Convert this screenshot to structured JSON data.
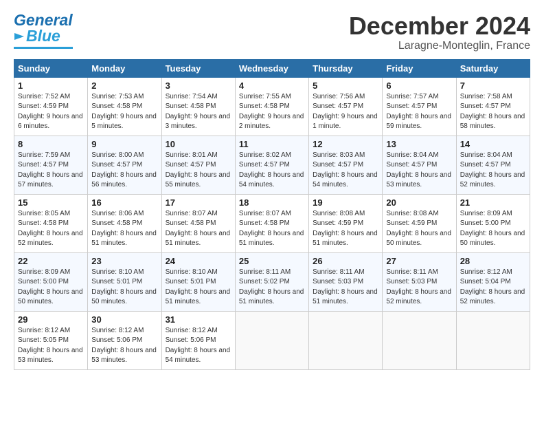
{
  "header": {
    "logo_general": "General",
    "logo_blue": "Blue",
    "month_title": "December 2024",
    "location": "Laragne-Monteglin, France"
  },
  "calendar": {
    "days_of_week": [
      "Sunday",
      "Monday",
      "Tuesday",
      "Wednesday",
      "Thursday",
      "Friday",
      "Saturday"
    ],
    "weeks": [
      [
        {
          "day": "1",
          "sunrise": "Sunrise: 7:52 AM",
          "sunset": "Sunset: 4:59 PM",
          "daylight": "Daylight: 9 hours and 6 minutes."
        },
        {
          "day": "2",
          "sunrise": "Sunrise: 7:53 AM",
          "sunset": "Sunset: 4:58 PM",
          "daylight": "Daylight: 9 hours and 5 minutes."
        },
        {
          "day": "3",
          "sunrise": "Sunrise: 7:54 AM",
          "sunset": "Sunset: 4:58 PM",
          "daylight": "Daylight: 9 hours and 3 minutes."
        },
        {
          "day": "4",
          "sunrise": "Sunrise: 7:55 AM",
          "sunset": "Sunset: 4:58 PM",
          "daylight": "Daylight: 9 hours and 2 minutes."
        },
        {
          "day": "5",
          "sunrise": "Sunrise: 7:56 AM",
          "sunset": "Sunset: 4:57 PM",
          "daylight": "Daylight: 9 hours and 1 minute."
        },
        {
          "day": "6",
          "sunrise": "Sunrise: 7:57 AM",
          "sunset": "Sunset: 4:57 PM",
          "daylight": "Daylight: 8 hours and 59 minutes."
        },
        {
          "day": "7",
          "sunrise": "Sunrise: 7:58 AM",
          "sunset": "Sunset: 4:57 PM",
          "daylight": "Daylight: 8 hours and 58 minutes."
        }
      ],
      [
        {
          "day": "8",
          "sunrise": "Sunrise: 7:59 AM",
          "sunset": "Sunset: 4:57 PM",
          "daylight": "Daylight: 8 hours and 57 minutes."
        },
        {
          "day": "9",
          "sunrise": "Sunrise: 8:00 AM",
          "sunset": "Sunset: 4:57 PM",
          "daylight": "Daylight: 8 hours and 56 minutes."
        },
        {
          "day": "10",
          "sunrise": "Sunrise: 8:01 AM",
          "sunset": "Sunset: 4:57 PM",
          "daylight": "Daylight: 8 hours and 55 minutes."
        },
        {
          "day": "11",
          "sunrise": "Sunrise: 8:02 AM",
          "sunset": "Sunset: 4:57 PM",
          "daylight": "Daylight: 8 hours and 54 minutes."
        },
        {
          "day": "12",
          "sunrise": "Sunrise: 8:03 AM",
          "sunset": "Sunset: 4:57 PM",
          "daylight": "Daylight: 8 hours and 54 minutes."
        },
        {
          "day": "13",
          "sunrise": "Sunrise: 8:04 AM",
          "sunset": "Sunset: 4:57 PM",
          "daylight": "Daylight: 8 hours and 53 minutes."
        },
        {
          "day": "14",
          "sunrise": "Sunrise: 8:04 AM",
          "sunset": "Sunset: 4:57 PM",
          "daylight": "Daylight: 8 hours and 52 minutes."
        }
      ],
      [
        {
          "day": "15",
          "sunrise": "Sunrise: 8:05 AM",
          "sunset": "Sunset: 4:58 PM",
          "daylight": "Daylight: 8 hours and 52 minutes."
        },
        {
          "day": "16",
          "sunrise": "Sunrise: 8:06 AM",
          "sunset": "Sunset: 4:58 PM",
          "daylight": "Daylight: 8 hours and 51 minutes."
        },
        {
          "day": "17",
          "sunrise": "Sunrise: 8:07 AM",
          "sunset": "Sunset: 4:58 PM",
          "daylight": "Daylight: 8 hours and 51 minutes."
        },
        {
          "day": "18",
          "sunrise": "Sunrise: 8:07 AM",
          "sunset": "Sunset: 4:58 PM",
          "daylight": "Daylight: 8 hours and 51 minutes."
        },
        {
          "day": "19",
          "sunrise": "Sunrise: 8:08 AM",
          "sunset": "Sunset: 4:59 PM",
          "daylight": "Daylight: 8 hours and 51 minutes."
        },
        {
          "day": "20",
          "sunrise": "Sunrise: 8:08 AM",
          "sunset": "Sunset: 4:59 PM",
          "daylight": "Daylight: 8 hours and 50 minutes."
        },
        {
          "day": "21",
          "sunrise": "Sunrise: 8:09 AM",
          "sunset": "Sunset: 5:00 PM",
          "daylight": "Daylight: 8 hours and 50 minutes."
        }
      ],
      [
        {
          "day": "22",
          "sunrise": "Sunrise: 8:09 AM",
          "sunset": "Sunset: 5:00 PM",
          "daylight": "Daylight: 8 hours and 50 minutes."
        },
        {
          "day": "23",
          "sunrise": "Sunrise: 8:10 AM",
          "sunset": "Sunset: 5:01 PM",
          "daylight": "Daylight: 8 hours and 50 minutes."
        },
        {
          "day": "24",
          "sunrise": "Sunrise: 8:10 AM",
          "sunset": "Sunset: 5:01 PM",
          "daylight": "Daylight: 8 hours and 51 minutes."
        },
        {
          "day": "25",
          "sunrise": "Sunrise: 8:11 AM",
          "sunset": "Sunset: 5:02 PM",
          "daylight": "Daylight: 8 hours and 51 minutes."
        },
        {
          "day": "26",
          "sunrise": "Sunrise: 8:11 AM",
          "sunset": "Sunset: 5:03 PM",
          "daylight": "Daylight: 8 hours and 51 minutes."
        },
        {
          "day": "27",
          "sunrise": "Sunrise: 8:11 AM",
          "sunset": "Sunset: 5:03 PM",
          "daylight": "Daylight: 8 hours and 52 minutes."
        },
        {
          "day": "28",
          "sunrise": "Sunrise: 8:12 AM",
          "sunset": "Sunset: 5:04 PM",
          "daylight": "Daylight: 8 hours and 52 minutes."
        }
      ],
      [
        {
          "day": "29",
          "sunrise": "Sunrise: 8:12 AM",
          "sunset": "Sunset: 5:05 PM",
          "daylight": "Daylight: 8 hours and 53 minutes."
        },
        {
          "day": "30",
          "sunrise": "Sunrise: 8:12 AM",
          "sunset": "Sunset: 5:06 PM",
          "daylight": "Daylight: 8 hours and 53 minutes."
        },
        {
          "day": "31",
          "sunrise": "Sunrise: 8:12 AM",
          "sunset": "Sunset: 5:06 PM",
          "daylight": "Daylight: 8 hours and 54 minutes."
        },
        null,
        null,
        null,
        null
      ]
    ]
  }
}
